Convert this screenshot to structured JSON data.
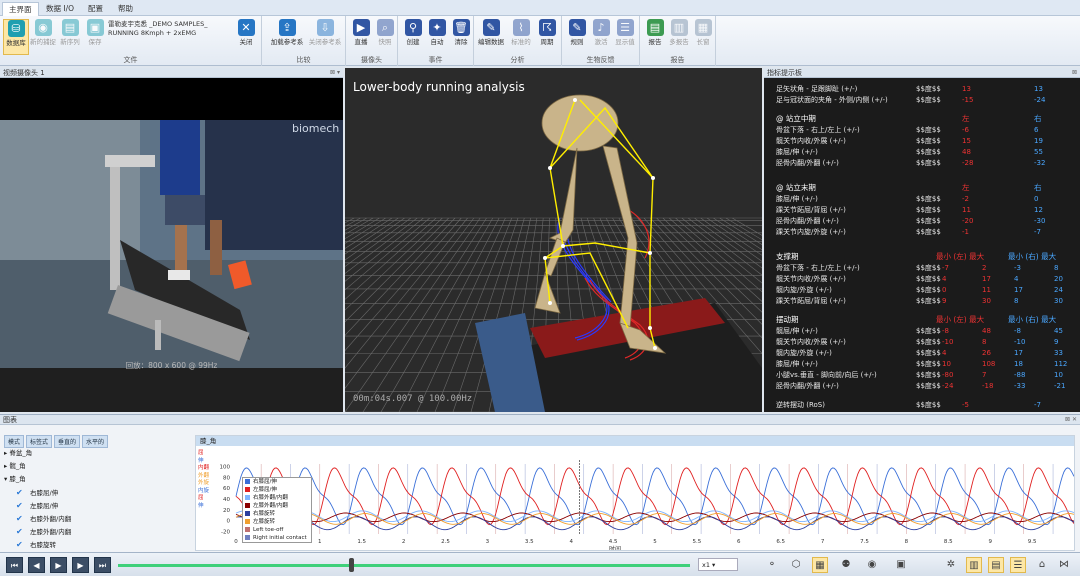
{
  "tabs": [
    "主界面",
    "数据 I/O",
    "配置",
    "帮助"
  ],
  "ribbon": {
    "file": {
      "label": "文件",
      "buttons": [
        "数据库",
        "新的捕捉",
        "新序列",
        "保存",
        "关闭"
      ]
    },
    "recording": {
      "line1": "雷勒麦宇克悉 _DEMO SAMPLES_",
      "line2": "RUNNING 8Kmph + 2xEMG"
    },
    "compare": {
      "label": "比较",
      "buttons": [
        "加载参考系",
        "关闭参考系"
      ]
    },
    "camera": {
      "label": "摄像头",
      "buttons": [
        "直播",
        "快照"
      ]
    },
    "events": {
      "label": "事件",
      "buttons": [
        "创建",
        "自动",
        "清除"
      ]
    },
    "analysis": {
      "label": "分析",
      "buttons": [
        "编辑数据",
        "标准的",
        "周期"
      ]
    },
    "biofeedback": {
      "label": "生物反馈",
      "buttons": [
        "规则",
        "激活",
        "显示值"
      ]
    },
    "report": {
      "label": "报告",
      "buttons": [
        "报告",
        "多报告",
        "长窗"
      ]
    }
  },
  "video": {
    "title": "视频摄像头 1",
    "caption": "回放：800 x 600 @ 99Hz"
  },
  "view3d": {
    "title": "Lower-body running analysis",
    "time": "00m:04s.007 @ 100.00Hz"
  },
  "metrics": {
    "title": "指标提示板",
    "top_rows": [
      {
        "label": "足矢状角 - 足跟脚趾 (+/-)",
        "unit": "$$度$$",
        "left": "13",
        "right": "13"
      },
      {
        "label": "足与冠状面的夹角 - 外侧/内侧 (+/-)",
        "unit": "$$度$$",
        "left": "-15",
        "right": "-24"
      }
    ],
    "sections": [
      {
        "title": "@ 站立中期",
        "left_head": "左",
        "right_head": "右",
        "rows": [
          {
            "label": "骨盆下落 - 右上/左上 (+/-)",
            "unit": "$$度$$",
            "left": "-6",
            "right": "6"
          },
          {
            "label": "髋关节内收/外展 (+/-)",
            "unit": "$$度$$",
            "left": "15",
            "right": "19"
          },
          {
            "label": "膝屈/伸 (+/-)",
            "unit": "$$度$$",
            "left": "48",
            "right": "55"
          },
          {
            "label": "胫骨内翻/外翻 (+/-)",
            "unit": "$$度$$",
            "left": "-28",
            "right": "-32"
          }
        ]
      },
      {
        "title": "@ 站立末期",
        "left_head": "左",
        "right_head": "右",
        "rows": [
          {
            "label": "膝屈/伸 (+/-)",
            "unit": "$$度$$",
            "left": "-2",
            "right": "0"
          },
          {
            "label": "踝关节跖屈/背屈 (+/-)",
            "unit": "$$度$$",
            "left": "11",
            "right": "12"
          },
          {
            "label": "胫骨内翻/外翻 (+/-)",
            "unit": "$$度$$",
            "left": "-20",
            "right": "-30"
          },
          {
            "label": "踝关节内旋/外旋 (+/-)",
            "unit": "$$度$$",
            "left": "-1",
            "right": "-7"
          }
        ]
      }
    ],
    "sections2": [
      {
        "title": "支撑期",
        "heads": [
          "最小 (左) 最大",
          "最小 (右) 最大"
        ],
        "rows": [
          {
            "label": "骨盆下落 - 右上/左上 (+/-)",
            "unit": "$$度$$",
            "v": [
              "-7",
              "2",
              "-3",
              "8"
            ]
          },
          {
            "label": "髋关节内收/外展 (+/-)",
            "unit": "$$度$$",
            "v": [
              "4",
              "17",
              "4",
              "20"
            ]
          },
          {
            "label": "髋内旋/外旋 (+/-)",
            "unit": "$$度$$",
            "v": [
              "0",
              "11",
              "17",
              "24"
            ]
          },
          {
            "label": "踝关节跖屈/背屈 (+/-)",
            "unit": "$$度$$",
            "v": [
              "9",
              "30",
              "8",
              "30"
            ]
          }
        ]
      },
      {
        "title": "摆动期",
        "heads": [
          "最小 (左) 最大",
          "最小 (右) 最大"
        ],
        "rows": [
          {
            "label": "髋屈/伸 (+/-)",
            "unit": "$$度$$",
            "v": [
              "-8",
              "48",
              "-8",
              "45"
            ]
          },
          {
            "label": "髋关节内收/外展 (+/-)",
            "unit": "$$度$$",
            "v": [
              "-10",
              "8",
              "-10",
              "9"
            ]
          },
          {
            "label": "髋内旋/外旋 (+/-)",
            "unit": "$$度$$",
            "v": [
              "4",
              "26",
              "17",
              "33"
            ]
          },
          {
            "label": "膝屈/伸 (+/-)",
            "unit": "$$度$$",
            "v": [
              "10",
              "108",
              "18",
              "112"
            ]
          },
          {
            "label": "小腿vs.垂直 - 脚向前/向后 (+/-)",
            "unit": "$$度$$",
            "v": [
              "-80",
              "7",
              "-88",
              "10"
            ]
          },
          {
            "label": "胫骨内翻/外翻 (+/-)",
            "unit": "$$度$$",
            "v": [
              "-24",
              "-18",
              "-33",
              "-21"
            ]
          }
        ]
      }
    ],
    "last": {
      "label": "逆转摆动 (RoS)",
      "unit": "$$度$$",
      "left": "-5",
      "right": "-7"
    }
  },
  "charts": {
    "title": "图表",
    "modes": [
      "模式",
      "标签式",
      "垂直的",
      "水平的"
    ],
    "tree": {
      "group1": "脊盆_角",
      "group2": "髋_角",
      "group3": "膝_角",
      "items": [
        "右膝屈/伸",
        "左膝屈/伸",
        "右膝外翻/内翻",
        "左膝外翻/内翻",
        "右膝旋转"
      ]
    },
    "header": "膝_角",
    "left_labels": [
      "屈",
      "伸",
      "内翻",
      "外翻",
      "外旋",
      "内旋",
      "屈",
      "伸"
    ],
    "xlabel": "时间"
  },
  "chart_data": {
    "type": "line",
    "ylim": [
      -25,
      105
    ],
    "yticks": [
      100,
      80,
      60,
      40,
      20,
      0,
      -20
    ],
    "xticks": [
      "0",
      "0.5",
      "1",
      "1.5",
      "2",
      "2.5",
      "3",
      "3.5",
      "4",
      "4.5",
      "5",
      "5.5",
      "6",
      "6.5",
      "7",
      "7.5",
      "8",
      "8.5",
      "9",
      "9.5"
    ],
    "xlim": [
      0,
      10
    ],
    "cursor_x": 4.1,
    "series": [
      {
        "name": "右膝屈/伸",
        "color": "#3a6fd8"
      },
      {
        "name": "左膝屈/伸",
        "color": "#e02020"
      },
      {
        "name": "右膝外翻/内翻",
        "color": "#7fb5ff"
      },
      {
        "name": "左膝外翻/内翻",
        "color": "#8b0000"
      },
      {
        "name": "右膝旋转",
        "color": "#2c3f9e"
      },
      {
        "name": "左膝旋转",
        "color": "#f0a030"
      },
      {
        "name": "Left toe-off",
        "color": "#c07070"
      },
      {
        "name": "Right initial contact",
        "color": "#7080c0"
      }
    ]
  },
  "transport": {
    "speed": "x1"
  }
}
